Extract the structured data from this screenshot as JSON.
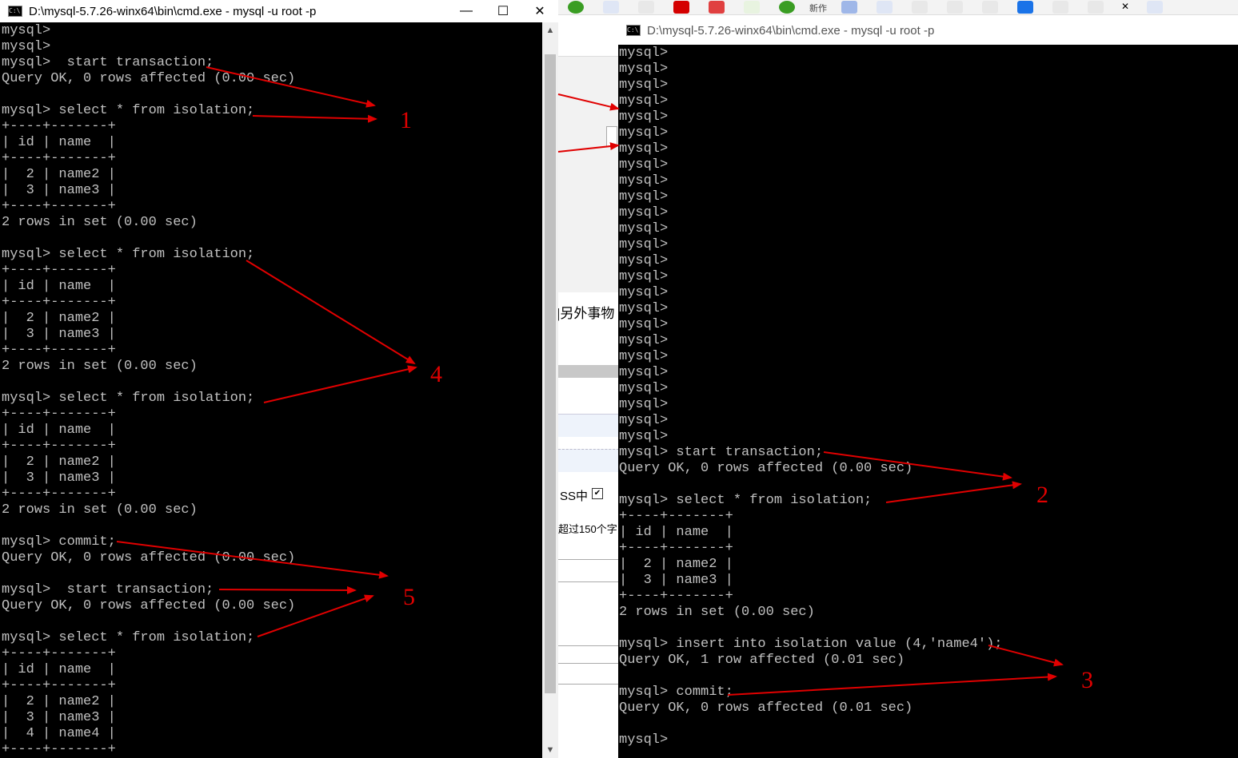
{
  "left_window": {
    "title": "D:\\mysql-5.7.26-winx64\\bin\\cmd.exe - mysql  -u root -p",
    "lines": [
      "mysql>",
      "mysql>",
      "mysql>  start transaction;",
      "Query OK, 0 rows affected (0.00 sec)",
      "",
      "mysql> select * from isolation;",
      "+----+-------+",
      "| id | name  |",
      "+----+-------+",
      "|  2 | name2 |",
      "|  3 | name3 |",
      "+----+-------+",
      "2 rows in set (0.00 sec)",
      "",
      "mysql> select * from isolation;",
      "+----+-------+",
      "| id | name  |",
      "+----+-------+",
      "|  2 | name2 |",
      "|  3 | name3 |",
      "+----+-------+",
      "2 rows in set (0.00 sec)",
      "",
      "mysql> select * from isolation;",
      "+----+-------+",
      "| id | name  |",
      "+----+-------+",
      "|  2 | name2 |",
      "|  3 | name3 |",
      "+----+-------+",
      "2 rows in set (0.00 sec)",
      "",
      "mysql> commit;",
      "Query OK, 0 rows affected (0.00 sec)",
      "",
      "mysql>  start transaction;",
      "Query OK, 0 rows affected (0.00 sec)",
      "",
      "mysql> select * from isolation;",
      "+----+-------+",
      "| id | name  |",
      "+----+-------+",
      "|  2 | name2 |",
      "|  3 | name3 |",
      "|  4 | name4 |",
      "+----+-------+"
    ]
  },
  "right_window": {
    "title": "D:\\mysql-5.7.26-winx64\\bin\\cmd.exe - mysql  -u root -p",
    "lines": [
      "mysql>",
      "mysql>",
      "mysql>",
      "mysql>",
      "mysql>",
      "mysql>",
      "mysql>",
      "mysql>",
      "mysql>",
      "mysql>",
      "mysql>",
      "mysql>",
      "mysql>",
      "mysql>",
      "mysql>",
      "mysql>",
      "mysql>",
      "mysql>",
      "mysql>",
      "mysql>",
      "mysql>",
      "mysql>",
      "mysql>",
      "mysql>",
      "mysql>",
      "mysql> start transaction;",
      "Query OK, 0 rows affected (0.00 sec)",
      "",
      "mysql> select * from isolation;",
      "+----+-------+",
      "| id | name  |",
      "+----+-------+",
      "|  2 | name2 |",
      "|  3 | name3 |",
      "+----+-------+",
      "2 rows in set (0.00 sec)",
      "",
      "mysql> insert into isolation value (4,'name4');",
      "Query OK, 1 row affected (0.01 sec)",
      "",
      "mysql> commit;",
      "Query OK, 0 rows affected (0.01 sec)",
      "",
      "mysql>"
    ]
  },
  "window_controls": {
    "minimize": "—",
    "maximize": "☐",
    "close": "✕"
  },
  "background": {
    "fragment_1": "|另外事物",
    "fragment_2": "SS中",
    "fragment_3": "超过150个字",
    "toolbar_text": "新作"
  },
  "annotations": {
    "n1": "1",
    "n2": "2",
    "n3": "3",
    "n4": "4",
    "n5": "5",
    "color": "#e00000"
  }
}
